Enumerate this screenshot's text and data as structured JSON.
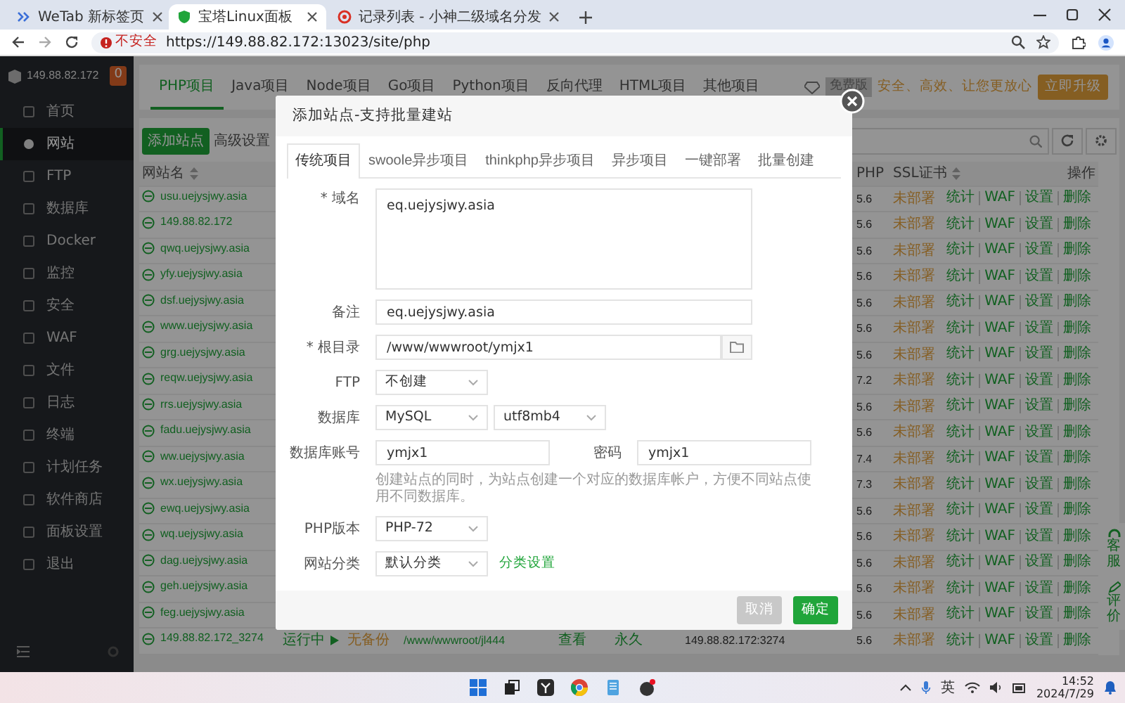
{
  "browser": {
    "tabs": [
      {
        "kind": "wetab",
        "title": "WeTab 新标签页",
        "selected": false
      },
      {
        "kind": "shield",
        "title": "宝塔Linux面板",
        "selected": true
      },
      {
        "kind": "record",
        "title": "记录列表 - 小神二级域名分发",
        "selected": false
      }
    ],
    "security_label": "不安全",
    "url": "https://149.88.82.172:13023/site/php"
  },
  "sidebar": {
    "host": "149.88.82.172",
    "badge": "0",
    "items": [
      {
        "label": "首页",
        "selected": false
      },
      {
        "label": "网站",
        "selected": true
      },
      {
        "label": "FTP",
        "selected": false
      },
      {
        "label": "数据库",
        "selected": false
      },
      {
        "label": "Docker",
        "selected": false
      },
      {
        "label": "监控",
        "selected": false
      },
      {
        "label": "安全",
        "selected": false
      },
      {
        "label": "WAF",
        "selected": false
      },
      {
        "label": "文件",
        "selected": false
      },
      {
        "label": "日志",
        "selected": false
      },
      {
        "label": "终端",
        "selected": false
      },
      {
        "label": "计划任务",
        "selected": false
      },
      {
        "label": "软件商店",
        "selected": false
      },
      {
        "label": "面板设置",
        "selected": false
      },
      {
        "label": "退出",
        "selected": false
      }
    ]
  },
  "project_tabs": [
    {
      "label": "PHP项目",
      "selected": true
    },
    {
      "label": "Java项目",
      "selected": false
    },
    {
      "label": "Node项目",
      "selected": false
    },
    {
      "label": "Go项目",
      "selected": false
    },
    {
      "label": "Python项目",
      "selected": false
    },
    {
      "label": "反向代理",
      "selected": false
    },
    {
      "label": "HTML项目",
      "selected": false
    },
    {
      "label": "其他项目",
      "selected": false
    }
  ],
  "promo": {
    "edition": "免费版",
    "slogan": "安全、高效、让您更放心",
    "button": "立即升级"
  },
  "toolbar": {
    "buttons": [
      {
        "kind": "primary",
        "label": "添加站点"
      },
      {
        "kind": "plain",
        "label": "高级设置"
      }
    ]
  },
  "table": {
    "columns": [
      {
        "label": "网站名",
        "sortable": true
      },
      {
        "label": "PHP",
        "sortable": false
      },
      {
        "label": "SSL证书",
        "sortable": true
      },
      {
        "label": "操作",
        "sortable": false
      }
    ],
    "rows": [
      {
        "site": "usu.uejysjwy.asia",
        "php": "5.6",
        "ssl": "未部署",
        "actions": [
          "统计",
          "WAF",
          "设置",
          "删除"
        ]
      },
      {
        "site": "149.88.82.172",
        "php": "5.6",
        "ssl": "未部署",
        "actions": [
          "统计",
          "WAF",
          "设置",
          "删除"
        ]
      },
      {
        "site": "qwq.uejysjwy.asia",
        "php": "5.6",
        "ssl": "未部署",
        "actions": [
          "统计",
          "WAF",
          "设置",
          "删除"
        ]
      },
      {
        "site": "yfy.uejysjwy.asia",
        "php": "5.6",
        "ssl": "未部署",
        "actions": [
          "统计",
          "WAF",
          "设置",
          "删除"
        ]
      },
      {
        "site": "dsf.uejysjwy.asia",
        "php": "5.6",
        "ssl": "未部署",
        "actions": [
          "统计",
          "WAF",
          "设置",
          "删除"
        ]
      },
      {
        "site": "www.uejysjwy.asia",
        "php": "5.6",
        "ssl": "未部署",
        "actions": [
          "统计",
          "WAF",
          "设置",
          "删除"
        ]
      },
      {
        "site": "grg.uejysjwy.asia",
        "php": "5.6",
        "ssl": "未部署",
        "actions": [
          "统计",
          "WAF",
          "设置",
          "删除"
        ]
      },
      {
        "site": "reqw.uejysjwy.asia",
        "php": "7.2",
        "ssl": "未部署",
        "actions": [
          "统计",
          "WAF",
          "设置",
          "删除"
        ]
      },
      {
        "site": "rrs.uejysjwy.asia",
        "php": "5.6",
        "ssl": "未部署",
        "actions": [
          "统计",
          "WAF",
          "设置",
          "删除"
        ]
      },
      {
        "site": "fadu.uejysjwy.asia",
        "php": "5.6",
        "ssl": "未部署",
        "actions": [
          "统计",
          "WAF",
          "设置",
          "删除"
        ]
      },
      {
        "site": "ww.uejysjwy.asia",
        "php": "7.4",
        "ssl": "未部署",
        "actions": [
          "统计",
          "WAF",
          "设置",
          "删除"
        ]
      },
      {
        "site": "wx.uejysjwy.asia",
        "php": "7.3",
        "ssl": "未部署",
        "actions": [
          "统计",
          "WAF",
          "设置",
          "删除"
        ]
      },
      {
        "site": "ewq.uejysjwy.asia",
        "php": "5.6",
        "ssl": "未部署",
        "actions": [
          "统计",
          "WAF",
          "设置",
          "删除"
        ]
      },
      {
        "site": "wq.uejysjwy.asia",
        "php": "5.6",
        "ssl": "未部署",
        "actions": [
          "统计",
          "WAF",
          "设置",
          "删除"
        ]
      },
      {
        "site": "dag.uejysjwy.asia",
        "php": "5.6",
        "ssl": "未部署",
        "actions": [
          "统计",
          "WAF",
          "设置",
          "删除"
        ]
      },
      {
        "site": "geh.uejysjwy.asia",
        "php": "5.6",
        "ssl": "未部署",
        "actions": [
          "统计",
          "WAF",
          "设置",
          "删除"
        ]
      },
      {
        "site": "feg.uejysjwy.asia",
        "php": "5.6",
        "ssl": "未部署",
        "actions": [
          "统计",
          "WAF",
          "设置",
          "删除"
        ]
      },
      {
        "site": "149.88.82.172_3274",
        "status": "运行中",
        "backup": "无备份",
        "root": "/www/wwwroot/jl444",
        "view": "查看",
        "expiry": "永久",
        "domain": "149.88.82.172:3274",
        "php": "5.6",
        "ssl": "未部署",
        "actions": [
          "统计",
          "WAF",
          "设置",
          "删除"
        ]
      }
    ]
  },
  "float_tabs": [
    {
      "kind": "service",
      "label": "客服"
    },
    {
      "kind": "review",
      "label": "评价"
    }
  ],
  "modal": {
    "title": "添加站点-支持批量建站",
    "tabs": [
      {
        "label": "传统项目",
        "selected": true
      },
      {
        "label": "swoole异步项目",
        "selected": false
      },
      {
        "label": "thinkphp异步项目",
        "selected": false
      },
      {
        "label": "异步项目",
        "selected": false
      },
      {
        "label": "一键部署",
        "selected": false
      },
      {
        "label": "批量创建",
        "selected": false
      }
    ],
    "fields": [
      {
        "kind": "textarea",
        "label": "* 域名",
        "value": "eq.uejysjwy.asia"
      },
      {
        "kind": "input",
        "label": "备注",
        "value": "eq.uejysjwy.asia"
      },
      {
        "kind": "path",
        "label": "* 根目录",
        "value": "/www/wwwroot/ymjx1"
      },
      {
        "kind": "select",
        "label": "FTP",
        "values": [
          "不创建"
        ]
      },
      {
        "kind": "select",
        "label": "数据库",
        "values": [
          "MySQL",
          "utf8mb4"
        ]
      },
      {
        "kind": "pair",
        "label": "数据库账号",
        "value": "ymjx1",
        "label_2": "密码",
        "value_2": "ymjx1"
      },
      {
        "kind": "help",
        "text": "创建站点的同时，为站点创建一个对应的数据库帐户，方便不同站点使用不同数据库。"
      },
      {
        "kind": "select",
        "label": "PHP版本",
        "values": [
          "PHP-72"
        ]
      },
      {
        "kind": "select",
        "label": "网站分类",
        "values": [
          "默认分类"
        ],
        "link": "分类设置"
      }
    ],
    "buttons": [
      {
        "kind": "cancel",
        "label": "取消"
      },
      {
        "kind": "confirm",
        "label": "确定"
      }
    ]
  },
  "taskbar": {
    "input_method": "英",
    "time": "14:52",
    "date": "2024/7/29"
  }
}
